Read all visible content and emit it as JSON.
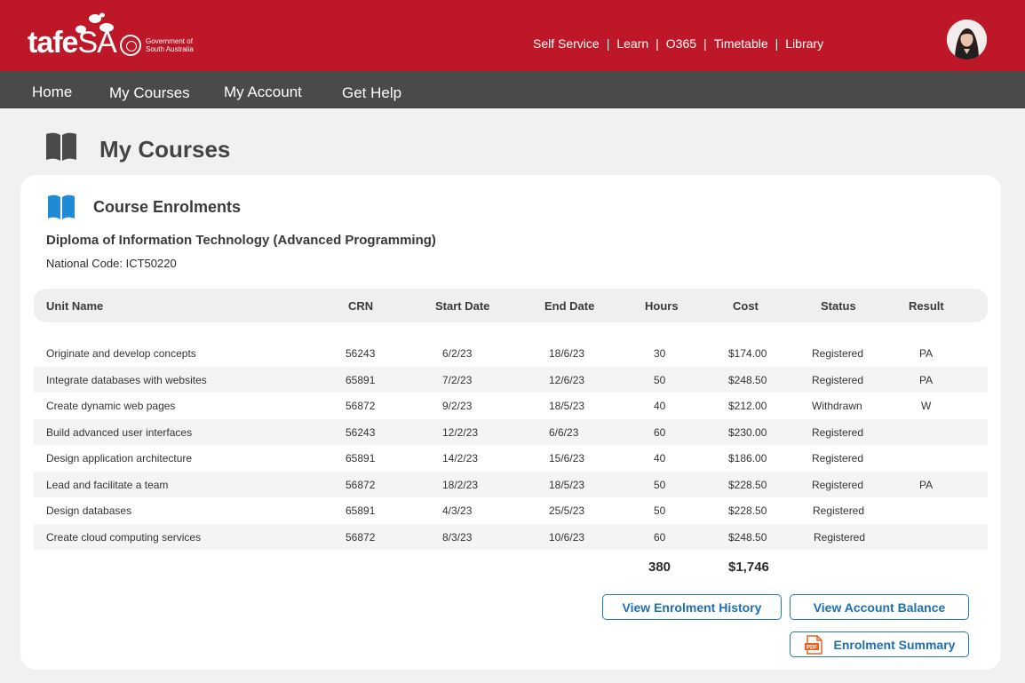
{
  "brand": {
    "logo_main": "tafe",
    "logo_accent": "SA",
    "gov_line1": "Government of",
    "gov_line2": "South Australia"
  },
  "top_links": [
    "Self Service",
    "Learn",
    "O365",
    "Timetable",
    "Library"
  ],
  "top_link_separator": "|",
  "nav": [
    "Home",
    "My Courses",
    "My Account",
    "Get Help"
  ],
  "page_title": "My Courses",
  "card": {
    "title": "Course Enrolments",
    "course_name": "Diploma of Information Technology (Advanced Programming)",
    "national_code": "National Code: ICT50220"
  },
  "table": {
    "headers": [
      "Unit Name",
      "CRN",
      "Start Date",
      "End Date",
      "Hours",
      "Cost",
      "Status",
      "Result"
    ],
    "rows": [
      [
        "Originate and develop concepts",
        "56243",
        "6/2/23",
        "18/6/23",
        "30",
        "$174.00",
        "Registered",
        "PA"
      ],
      [
        "Integrate databases with websites",
        "65891",
        "7/2/23",
        "12/6/23",
        "50",
        "$248.50",
        "Registered",
        "PA"
      ],
      [
        "Create dynamic web pages",
        "56872",
        "9/2/23",
        "18/5/23",
        "40",
        "$212.00",
        "Withdrawn",
        "W"
      ],
      [
        "Build advanced user interfaces",
        "56243",
        "12/2/23",
        "6/6/23",
        "60",
        "$230.00",
        "Registered",
        ""
      ],
      [
        "Design application architecture",
        "65891",
        "14/2/23",
        "15/6/23",
        "40",
        "$186.00",
        "Registered",
        ""
      ],
      [
        "Lead and facilitate a team",
        "56872",
        "18/2/23",
        "18/5/23",
        "50",
        "$228.50",
        "Registered",
        "PA"
      ],
      [
        "Design databases",
        "65891",
        "4/3/23",
        "25/5/23",
        "50",
        "$228.50",
        "Registered",
        ""
      ],
      [
        "Create cloud computing services",
        "56872",
        "8/3/23",
        "10/6/23",
        "60",
        "$248.50",
        "Registered",
        ""
      ]
    ],
    "total_hours": "380",
    "total_cost": "$1,746"
  },
  "buttons": {
    "history": "View Enrolment History",
    "balance": "View Account Balance",
    "summary": "Enrolment Summary",
    "pdf_label": "PDF"
  },
  "colors": {
    "brand_red": "#be1828",
    "nav_gray": "#4a4a4a",
    "accent_blue": "#1e7ac4",
    "pdf_orange": "#e8621f"
  },
  "icons": {
    "page": "open-book-icon",
    "card": "open-book-icon",
    "summary": "pdf-file-icon"
  }
}
